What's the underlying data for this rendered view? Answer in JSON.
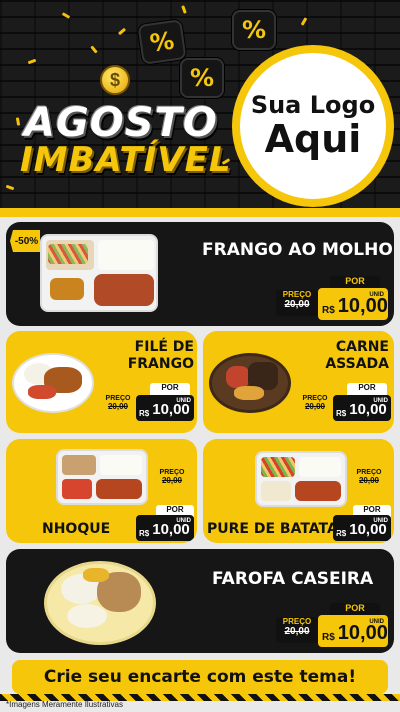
{
  "header": {
    "coin_symbol": "$",
    "title_line1": "AGOSTO",
    "title_line2": "IMBATÍVEL",
    "percent_symbol": "%",
    "logo_line1": "Sua Logo",
    "logo_line2": "Aqui"
  },
  "discount_badge": "-50%",
  "price_common": {
    "old_label": "PREÇO",
    "old_value": "20,00",
    "new_label": "POR",
    "currency": "R$",
    "unit": "UNID",
    "new_value": "10,00"
  },
  "products": [
    {
      "name": "FRANGO AO MOLHO"
    },
    {
      "name_line1": "FILÉ DE",
      "name_line2": "FRANGO"
    },
    {
      "name_line1": "CARNE",
      "name_line2": "ASSADA"
    },
    {
      "name": "NHOQUE"
    },
    {
      "name": "PURE DE BATATA"
    },
    {
      "name": "FAROFA CASEIRA"
    }
  ],
  "cta": "Crie seu encarte com este tema!",
  "disclaimer": "*Imagens Meramente Ilustrativas",
  "colors": {
    "yellow": "#f5c60a",
    "dark": "#161616"
  }
}
